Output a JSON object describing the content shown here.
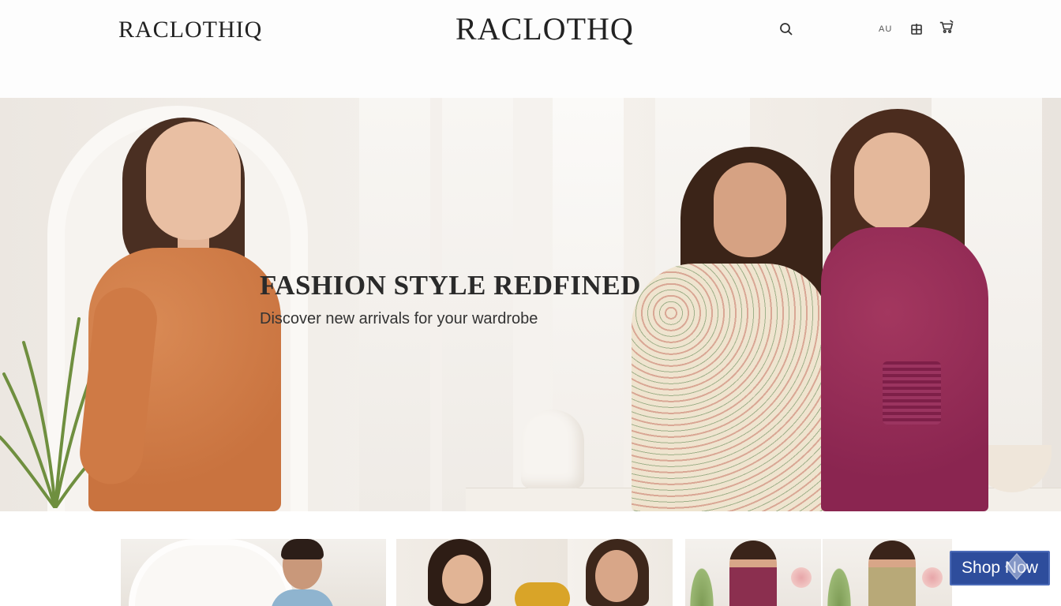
{
  "header": {
    "logo_left": "RACLOTHIQ",
    "logo_center": "RACLOTHQ",
    "region_label": "AU",
    "icons": [
      "search-icon",
      "grid-icon",
      "cart-icon"
    ]
  },
  "hero": {
    "title": "FASHION STYLE REDFINED",
    "subtitle": "Discover new arrivals for your wardrobe"
  },
  "products": {
    "cards": [
      "product-card-1",
      "product-card-2",
      "product-card-3",
      "product-card-4"
    ]
  },
  "cta": {
    "label": "Shop Now",
    "color": "#2e4d9c"
  },
  "colors": {
    "background": "#ffffff",
    "text": "#222222",
    "accent": "#2e4d9c"
  }
}
